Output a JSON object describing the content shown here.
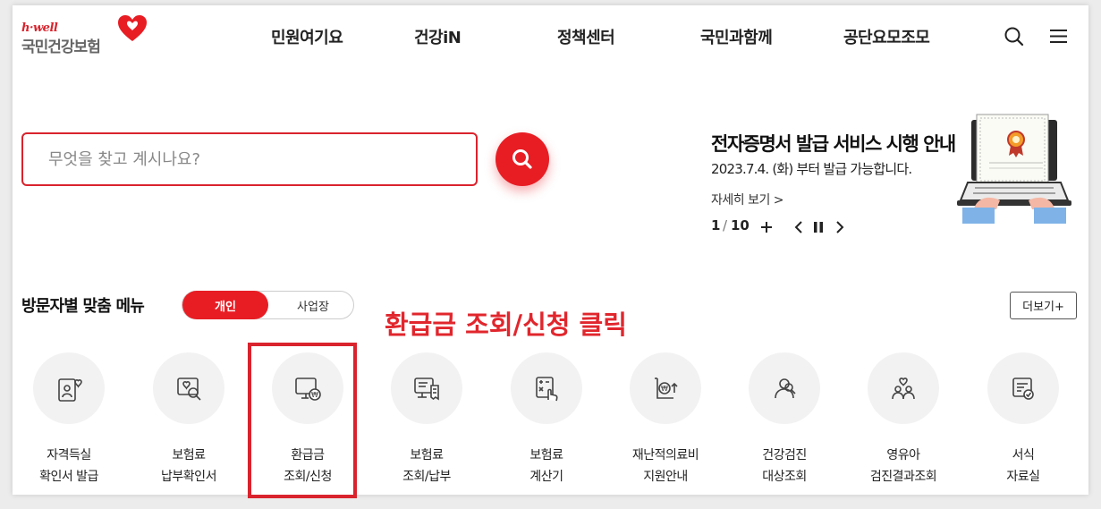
{
  "header": {
    "logo_small": "h·well",
    "logo_big": "국민건강보험",
    "nav": [
      "민원여기요",
      "건강iN",
      "정책센터",
      "국민과함께",
      "공단요모조모"
    ]
  },
  "search": {
    "placeholder": "무엇을 찾고 계시나요?"
  },
  "notice": {
    "title": "전자증명서 발급 서비스 시행 안내",
    "subtitle": "2023.7.4. (화) 부터 발급 가능합니다.",
    "more": "자세히 보기 >",
    "current": "1",
    "separator": "/",
    "total": "10"
  },
  "visitor_menu": {
    "title": "방문자별 맞춤 메뉴",
    "toggle_on": "개인",
    "toggle_off": "사업장",
    "more": "더보기+",
    "annotation": "환급금 조회/신청 클릭",
    "items": [
      {
        "icon": "id-card-heart-icon",
        "line1": "자격득실",
        "line2": "확인서 발급"
      },
      {
        "icon": "document-search-icon",
        "line1": "보험료",
        "line2": "납부확인서"
      },
      {
        "icon": "monitor-won-icon",
        "line1": "환급금",
        "line2": "조회/신청"
      },
      {
        "icon": "monitor-receipt-icon",
        "line1": "보험료",
        "line2": "조회/납부"
      },
      {
        "icon": "calculator-icon",
        "line1": "보험료",
        "line2": "계산기"
      },
      {
        "icon": "won-support-icon",
        "line1": "재난적의료비",
        "line2": "지원안내"
      },
      {
        "icon": "person-check-icon",
        "line1": "건강검진",
        "line2": "대상조회"
      },
      {
        "icon": "family-heart-icon",
        "line1": "영유아",
        "line2": "검진결과조회"
      },
      {
        "icon": "document-check-icon",
        "line1": "서식",
        "line2": "자료실"
      }
    ]
  },
  "colors": {
    "accent": "#e81d24",
    "annotation": "#e1262d",
    "icon_bg": "#f2f2f2"
  }
}
